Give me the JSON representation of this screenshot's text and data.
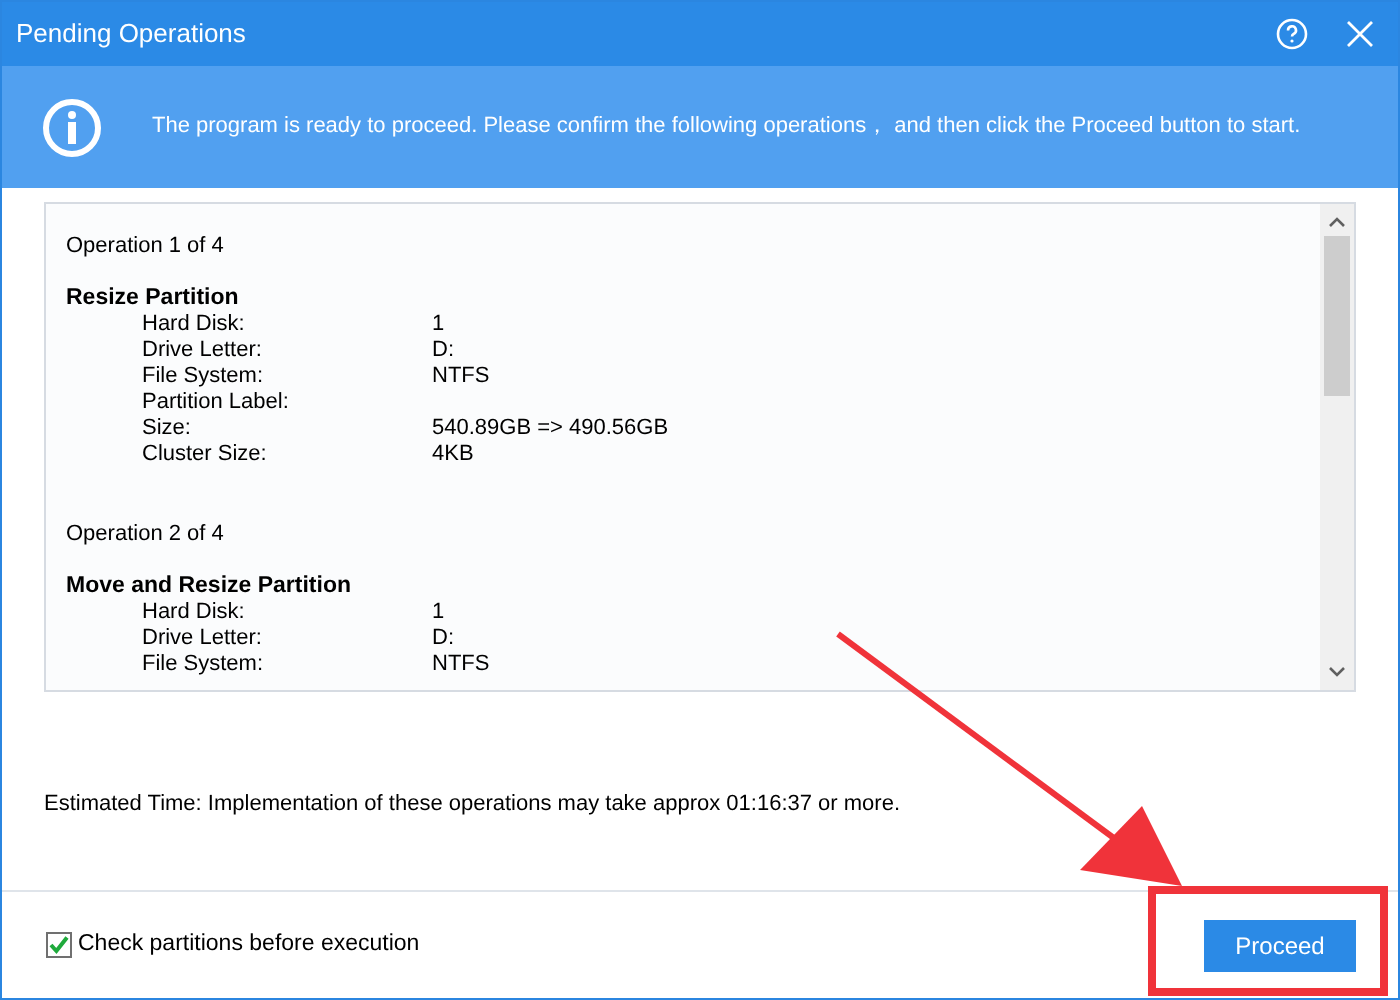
{
  "window": {
    "title": "Pending Operations"
  },
  "banner": {
    "message": "The program is ready to proceed. Please confirm the following operations， and then click the Proceed button to start."
  },
  "operations": [
    {
      "counter": "Operation 1 of 4",
      "name": "Resize Partition",
      "fields": [
        {
          "label": "Hard Disk:",
          "value": "1"
        },
        {
          "label": "Drive Letter:",
          "value": "D:"
        },
        {
          "label": "File System:",
          "value": "NTFS"
        },
        {
          "label": "Partition Label:"
        },
        {
          "label": "Size:",
          "value": "540.89GB => 490.56GB"
        },
        {
          "label": "Cluster Size:",
          "value": "4KB"
        }
      ]
    },
    {
      "counter": "Operation 2 of 4",
      "name": "Move and Resize Partition",
      "fields": [
        {
          "label": "Hard Disk:",
          "value": "1"
        },
        {
          "label": "Drive Letter:",
          "value": "D:"
        },
        {
          "label": "File System:",
          "value": "NTFS"
        }
      ]
    }
  ],
  "estimate": "Estimated Time: Implementation of these operations may take approx 01:16:37 or more.",
  "footer": {
    "checkbox": {
      "label": "Check partitions before execution",
      "checked": true
    },
    "button": "Proceed"
  }
}
